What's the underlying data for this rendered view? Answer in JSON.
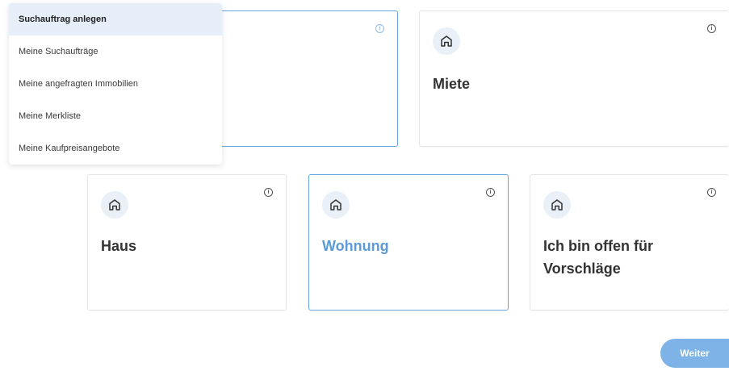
{
  "menu": {
    "items": [
      {
        "label": "Suchauftrag anlegen",
        "active": true
      },
      {
        "label": "Meine Suchaufträge",
        "active": false
      },
      {
        "label": "Meine angefragten Immobilien",
        "active": false
      },
      {
        "label": "Meine Merkliste",
        "active": false
      },
      {
        "label": "Meine Kaufpreisangebote",
        "active": false
      }
    ]
  },
  "cards": {
    "miete": {
      "title": "Miete"
    },
    "haus": {
      "title": "Haus"
    },
    "wohnung": {
      "title": "Wohnung"
    },
    "offen": {
      "title_line1": "Ich bin offen für",
      "title_line2": "Vorschläge"
    }
  },
  "icons": {
    "card": "home-icon",
    "info": "info-icon"
  },
  "colors": {
    "accent": "#5a9bd8",
    "selected_border": "#6aa6dd",
    "button": "#7db3e6",
    "menu_active": "#e6eef9"
  },
  "actions": {
    "next_label": "Weiter"
  }
}
